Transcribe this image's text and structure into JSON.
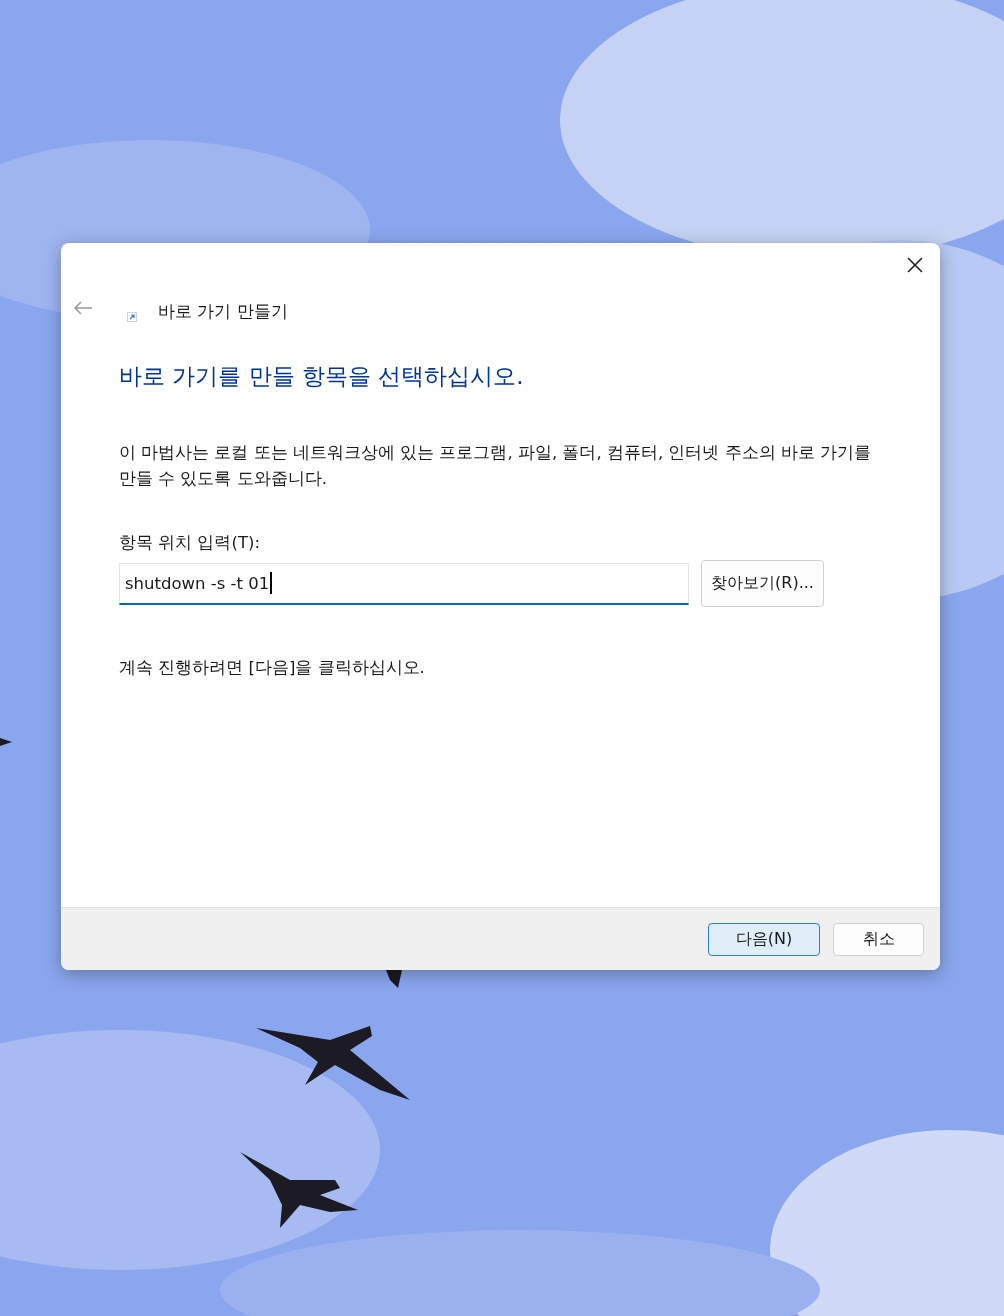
{
  "dialog": {
    "title": "바로 가기 만들기",
    "back_button": {
      "disabled": true
    },
    "heading": "바로 가기를 만들 항목을 선택하십시오.",
    "description": "이 마법사는 로컬 또는 네트워크상에 있는 프로그램, 파일, 폴더, 컴퓨터, 인터넷 주소의 바로 가기를 만들 수 있도록 도와줍니다.",
    "location_field": {
      "label": "항목 위치 입력(T):",
      "value": "shutdown -s -t 01",
      "focused": true
    },
    "browse_button": "찾아보기(R)...",
    "hint": "계속 진행하려면 [다음]을 클릭하십시오.",
    "buttons": [
      {
        "label": "다음(N)",
        "default": true
      },
      {
        "label": "취소",
        "default": false
      }
    ]
  }
}
